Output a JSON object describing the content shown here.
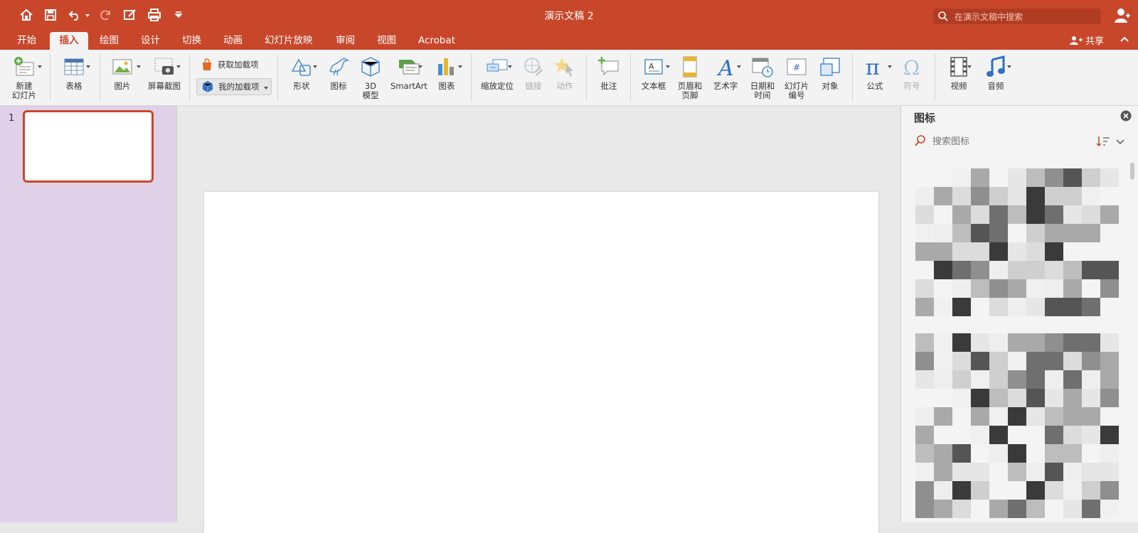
{
  "window": {
    "title": "演示文稿 2"
  },
  "search": {
    "placeholder": "在演示文稿中搜索"
  },
  "colors": {
    "accent": "#c8472b",
    "left_pane": "#e0d0e8",
    "ribbon": "#f3f3f3"
  },
  "tabs": [
    {
      "label": "开始",
      "active": false
    },
    {
      "label": "插入",
      "active": true
    },
    {
      "label": "绘图",
      "active": false
    },
    {
      "label": "设计",
      "active": false
    },
    {
      "label": "切换",
      "active": false
    },
    {
      "label": "动画",
      "active": false
    },
    {
      "label": "幻灯片放映",
      "active": false
    },
    {
      "label": "审阅",
      "active": false
    },
    {
      "label": "视图",
      "active": false
    },
    {
      "label": "Acrobat",
      "active": false
    }
  ],
  "share": {
    "label": "共享"
  },
  "ribbon": {
    "new_slide": "新建\n幻灯片",
    "table": "表格",
    "picture": "图片",
    "screenshot": "屏幕截图",
    "get_addins": "获取加载项",
    "my_addins": "我的加载项",
    "shapes": "形状",
    "icons": "图标",
    "model3d": "3D\n模型",
    "smartart": "SmartArt",
    "chart": "图表",
    "zoom": "缩放定位",
    "link": "链接",
    "action": "动作",
    "comment": "批注",
    "textbox": "文本框",
    "header_footer": "页眉和\n页脚",
    "wordart": "艺术字",
    "date_time": "日期和\n时间",
    "slide_number": "幻灯片\n编号",
    "object": "对象",
    "equation": "公式",
    "symbol": "符号",
    "video": "视频",
    "audio": "音频"
  },
  "slides": {
    "number": "1"
  },
  "icons_pane": {
    "title": "图标",
    "search_placeholder": "搜索图标"
  }
}
